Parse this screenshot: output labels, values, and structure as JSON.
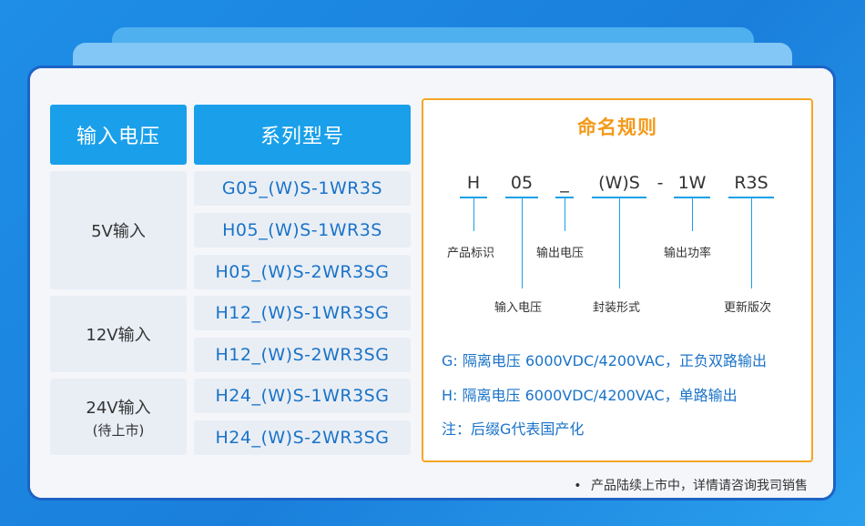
{
  "table": {
    "header_input": "输入电压",
    "header_series": "系列型号",
    "groups": [
      {
        "label": "5V输入",
        "sub": ""
      },
      {
        "label": "12V输入",
        "sub": ""
      },
      {
        "label": "24V输入",
        "sub": "(待上市)"
      }
    ],
    "models": [
      "G05_(W)S-1WR3S",
      "H05_(W)S-1WR3S",
      "H05_(W)S-2WR3SG",
      "H12_(W)S-1WR3SG",
      "H12_(W)S-2WR3SG",
      "H24_(W)S-1WR3SG",
      "H24_(W)S-2WR3SG"
    ]
  },
  "naming": {
    "title": "命名规则",
    "segments": [
      "H",
      "05",
      "_",
      "(W)S",
      "-",
      "1W",
      "R3S"
    ],
    "labels": {
      "product_id": "产品标识",
      "input_voltage": "输入电压",
      "output_voltage": "输出电压",
      "package": "封装形式",
      "output_power": "输出功率",
      "version": "更新版次"
    },
    "notes": [
      "G: 隔离电压 6000VDC/4200VAC，正负双路输出",
      "H: 隔离电压 6000VDC/4200VAC，单路输出",
      "注：后缀G代表国产化"
    ]
  },
  "footer": {
    "bullet": "•",
    "text": "产品陆续上市中，详情请咨询我司销售"
  }
}
